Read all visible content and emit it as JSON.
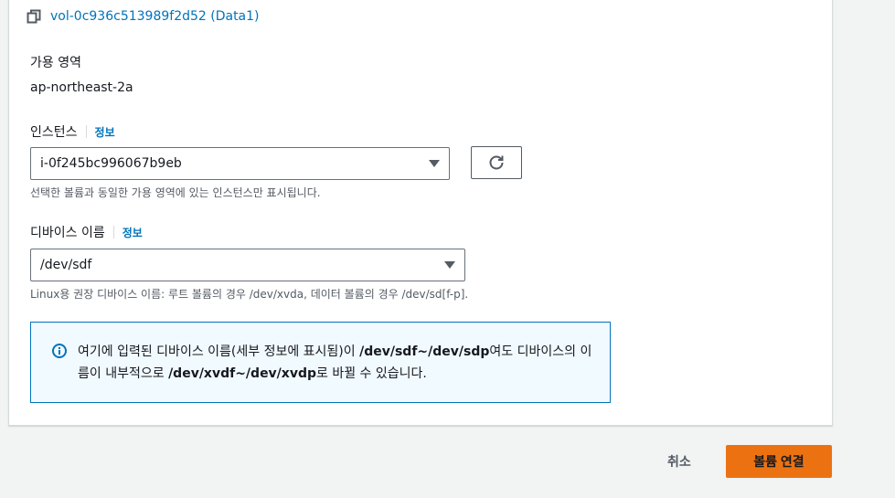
{
  "volume": {
    "link_text": "vol-0c936c513989f2d52 (Data1)"
  },
  "availability_zone": {
    "label": "가용 영역",
    "value": "ap-northeast-2a"
  },
  "instance": {
    "label": "인스턴스",
    "info": "정보",
    "selected": "i-0f245bc996067b9eb",
    "hint": "선택한 볼륨과 동일한 가용 영역에 있는 인스턴스만 표시됩니다."
  },
  "device": {
    "label": "디바이스 이름",
    "info": "정보",
    "selected": "/dev/sdf",
    "hint": "Linux용 권장 디바이스 이름: 루트 볼륨의 경우 /dev/xvda, 데이터 볼륨의 경우 /dev/sd[f-p]."
  },
  "alert": {
    "part1": "여기에 입력된 디바이스 이름(세부 정보에 표시됨)이 ",
    "bold1": "/dev/sdf~/dev/sdp",
    "part2": "여도 디바이스의 이름이 내부적으로 ",
    "bold2": "/dev/xvdf~/dev/xvdp",
    "part3": "로 바뀔 수 있습니다."
  },
  "actions": {
    "cancel": "취소",
    "primary": "볼륨 연결"
  },
  "colors": {
    "link": "#0073bb",
    "primary": "#ec7211",
    "alert_bg": "#f1faff"
  }
}
